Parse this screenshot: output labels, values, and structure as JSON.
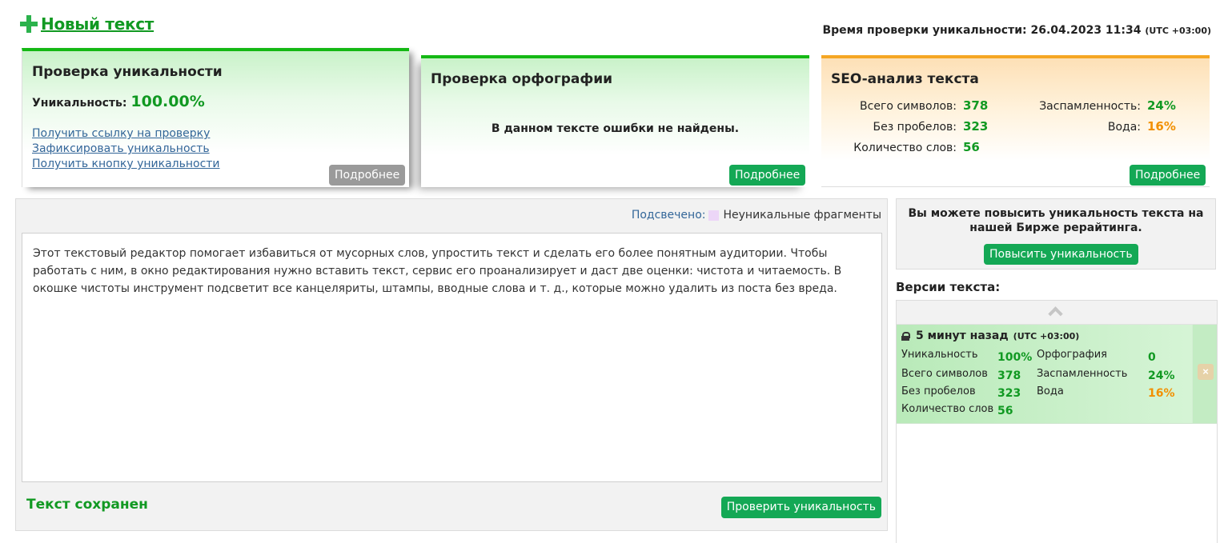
{
  "header": {
    "new_text_label": "Новый текст",
    "check_time_label": "Время проверки уникальности: 26.04.2023 11:34",
    "check_time_tz": "(UTC +03:00)"
  },
  "uniqueness_card": {
    "title": "Проверка уникальности",
    "uniq_label": "Уникальность:",
    "uniq_value": "100.00%",
    "links": [
      "Получить ссылку на проверку",
      "Зафиксировать уникальность",
      "Получить кнопку уникальности"
    ],
    "details_button": "Подробнее"
  },
  "spelling_card": {
    "title": "Проверка орфографии",
    "message": "В данном тексте ошибки не найдены.",
    "details_button": "Подробнее"
  },
  "seo_card": {
    "title": "SEO-анализ текста",
    "total_chars_label": "Всего символов:",
    "total_chars_value": "378",
    "no_spaces_label": "Без пробелов:",
    "no_spaces_value": "323",
    "words_label": "Количество слов:",
    "words_value": "56",
    "spam_label": "Заспамленность:",
    "spam_value": "24%",
    "water_label": "Вода:",
    "water_value": "16%",
    "details_button": "Подробнее"
  },
  "editor": {
    "highlight_label": "Подсвечено:",
    "highlight_legend": "Неуникальные фрагменты",
    "text": "Этот текстовый редактор помогает избавиться от мусорных слов, упростить текст и сделать его более понятным аудитории. Чтобы работать с ним, в окно редактирования нужно вставить текст, сервис его проанализирует и даст две оценки: чистота и читаемость. В окошке чистоты инструмент подсветит все канцеляриты, штампы, вводные слова и т. д., которые можно удалить из поста без вреда.",
    "saved_status": "Текст сохранен",
    "check_button": "Проверить уникальность"
  },
  "promo": {
    "text": "Вы можете повысить уникальность текста на нашей Бирже рерайтинга.",
    "button": "Повысить уникальность"
  },
  "versions": {
    "title": "Версии текста:",
    "items": [
      {
        "time": "5 минут назад",
        "tz": "(UTC +03:00)",
        "uniq_label": "Уникальность",
        "uniq_value": "100%",
        "chars_label": "Всего символов",
        "chars_value": "378",
        "no_spaces_label": "Без пробелов",
        "no_spaces_value": "323",
        "words_label": "Количество слов",
        "words_value": "56",
        "spelling_label": "Орфография",
        "spelling_value": "0",
        "spam_label": "Заспамленность",
        "spam_value": "24%",
        "water_label": "Вода",
        "water_value": "16%"
      }
    ]
  },
  "colors": {
    "green_accent": "#14b814",
    "button_green": "#14a855",
    "value_green": "#119922",
    "orange": "#f29000",
    "link_blue": "#336699"
  }
}
